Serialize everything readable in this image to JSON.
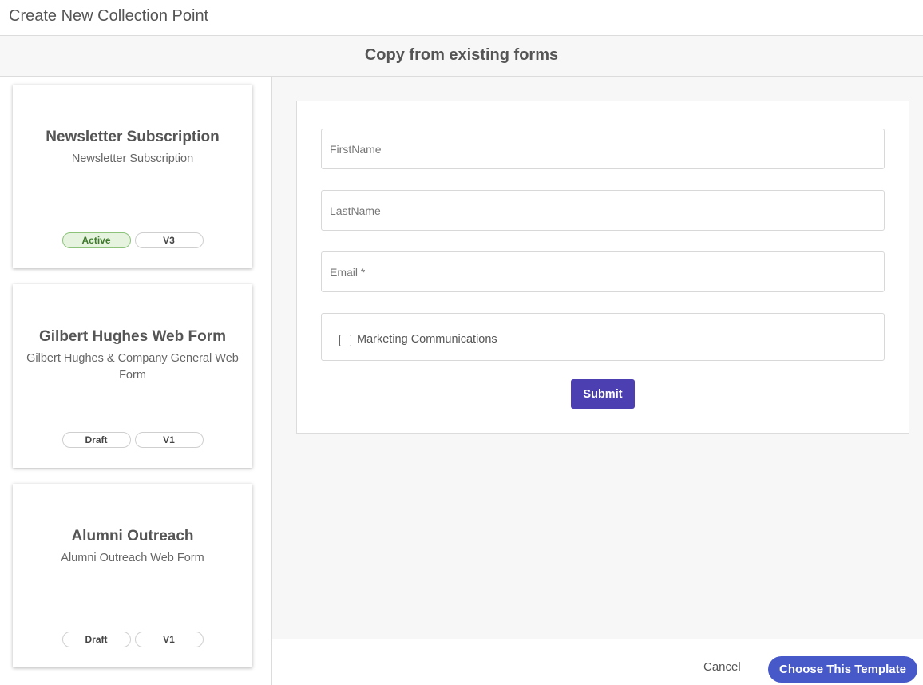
{
  "header": {
    "title": "Create New Collection Point"
  },
  "section": {
    "title": "Copy from existing forms"
  },
  "templates": [
    {
      "title": "Newsletter Subscription",
      "description": "Newsletter Subscription",
      "status": "Active",
      "version": "V3"
    },
    {
      "title": "Gilbert Hughes Web Form",
      "description": "Gilbert Hughes & Company General Web Form",
      "status": "Draft",
      "version": "V1"
    },
    {
      "title": "Alumni Outreach",
      "description": "Alumni Outreach Web Form",
      "status": "Draft",
      "version": "V1"
    }
  ],
  "form": {
    "first_name": {
      "placeholder": "FirstName",
      "value": ""
    },
    "last_name": {
      "placeholder": "LastName",
      "value": ""
    },
    "email": {
      "placeholder": "Email *",
      "value": ""
    },
    "checkbox_label": "Marketing Communications",
    "submit_label": "Submit"
  },
  "footer": {
    "cancel_label": "Cancel",
    "choose_label": "Choose This Template"
  },
  "colors": {
    "active_badge_bg": "#e6f4df",
    "submit_bg": "#4b3fb1",
    "choose_bg": "#4759c9"
  }
}
